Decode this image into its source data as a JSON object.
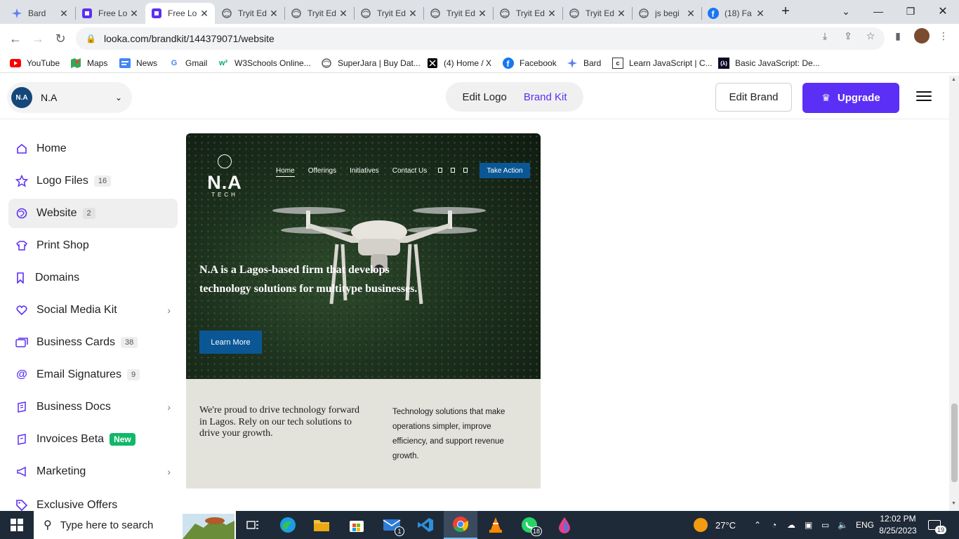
{
  "browser": {
    "tabs": [
      {
        "title": "Bard",
        "favicon": "bard-icon"
      },
      {
        "title": "Free Lo",
        "favicon": "looka-icon"
      },
      {
        "title": "Free Lo",
        "favicon": "looka-icon",
        "active": true
      },
      {
        "title": "Tryit Ed",
        "favicon": "globe-icon"
      },
      {
        "title": "Tryit Ed",
        "favicon": "globe-icon"
      },
      {
        "title": "Tryit Ed",
        "favicon": "globe-icon"
      },
      {
        "title": "Tryit Ed",
        "favicon": "globe-icon"
      },
      {
        "title": "Tryit Ed",
        "favicon": "globe-icon"
      },
      {
        "title": "Tryit Ed",
        "favicon": "globe-icon"
      },
      {
        "title": "js begi",
        "favicon": "globe-icon"
      },
      {
        "title": "(18) Fa",
        "favicon": "facebook-icon"
      }
    ],
    "url": "looka.com/brandkit/144379071/website",
    "bookmarks": [
      {
        "label": "YouTube",
        "icon": "youtube-icon"
      },
      {
        "label": "Maps",
        "icon": "maps-icon"
      },
      {
        "label": "News",
        "icon": "news-icon"
      },
      {
        "label": "Gmail",
        "icon": "google-icon"
      },
      {
        "label": "W3Schools Online...",
        "icon": "w3schools-icon"
      },
      {
        "label": "SuperJara | Buy Dat...",
        "icon": "globe-icon"
      },
      {
        "label": "(4) Home / X",
        "icon": "x-icon"
      },
      {
        "label": "Facebook",
        "icon": "facebook-icon"
      },
      {
        "label": "Bard",
        "icon": "bard-icon"
      },
      {
        "label": "Learn JavaScript | C...",
        "icon": "learn-js-icon"
      },
      {
        "label": "Basic JavaScript: De...",
        "icon": "fcc-icon"
      }
    ]
  },
  "header": {
    "brand_name": "N.A",
    "avatar_text": "N.A",
    "seg_edit_logo": "Edit Logo",
    "seg_brand_kit": "Brand Kit",
    "edit_brand": "Edit Brand",
    "upgrade": "Upgrade",
    "accent": "#5b2ff5"
  },
  "sidebar": {
    "items": [
      {
        "label": "Home",
        "icon": "home-icon"
      },
      {
        "label": "Logo Files",
        "icon": "star-icon",
        "count": "16"
      },
      {
        "label": "Website",
        "icon": "globe-icon",
        "count": "2",
        "active": true
      },
      {
        "label": "Print Shop",
        "icon": "shirt-icon"
      },
      {
        "label": "Domains",
        "icon": "bookmark-icon"
      },
      {
        "label": "Social Media Kit",
        "icon": "heart-icon",
        "chevron": true
      },
      {
        "label": "Business Cards",
        "icon": "cards-icon",
        "count": "38"
      },
      {
        "label": "Email Signatures",
        "icon": "at-icon",
        "count": "9"
      },
      {
        "label": "Business Docs",
        "icon": "docs-icon",
        "chevron": true
      },
      {
        "label": "Invoices Beta",
        "icon": "invoice-icon",
        "badge": "New"
      },
      {
        "label": "Marketing",
        "icon": "megaphone-icon",
        "chevron": true
      },
      {
        "label": "Exclusive Offers",
        "icon": "tag-icon"
      }
    ]
  },
  "preview": {
    "logo_name": "N.A",
    "logo_tagline": "TECH",
    "nav": [
      "Home",
      "Offerings",
      "Initiatives",
      "Contact Us"
    ],
    "cta": "Take Action",
    "headline": "N.A is a Lagos-based firm that develops technology solutions for multitype businesses.",
    "learn_more": "Learn More",
    "text_left": "We're proud to drive technology forward in Lagos. Rely on our tech solutions to drive your growth.",
    "text_right": "Technology solutions that make operations simpler, improve efficiency, and support revenue growth.",
    "button_color": "#0b5796"
  },
  "taskbar": {
    "search_placeholder": "Type here to search",
    "weather": "27°C",
    "lang": "ENG",
    "time": "12:02 PM",
    "date": "8/25/2023",
    "mail_badge": "1",
    "whatsapp_badge": "18",
    "notif_count": "19"
  }
}
